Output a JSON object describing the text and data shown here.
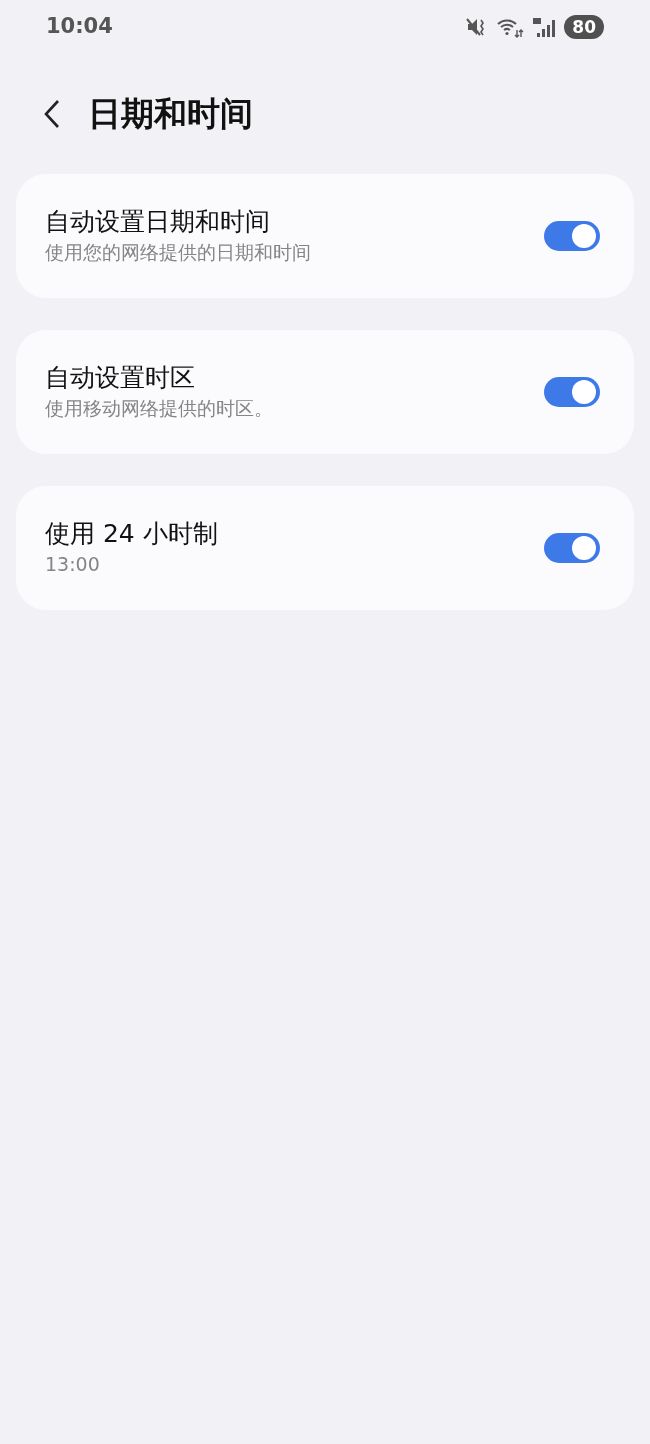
{
  "status_bar": {
    "time": "10:04",
    "battery": "80"
  },
  "header": {
    "title": "日期和时间"
  },
  "settings": [
    {
      "title": "自动设置日期和时间",
      "subtitle": "使用您的网络提供的日期和时间",
      "on": true
    },
    {
      "title": "自动设置时区",
      "subtitle": "使用移动网络提供的时区。",
      "on": true
    },
    {
      "title": "使用 24 小时制",
      "subtitle": "13:00",
      "on": true
    }
  ]
}
